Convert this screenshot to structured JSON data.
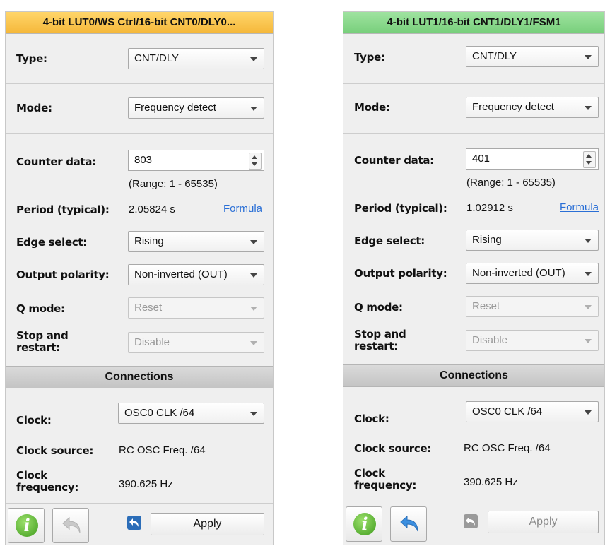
{
  "panels": [
    {
      "title": "4-bit LUT0/WS Ctrl/16-bit CNT0/DLY0...",
      "title_color": "#f5b83a",
      "type": {
        "label": "Type:",
        "value": "CNT/DLY"
      },
      "mode": {
        "label": "Mode:",
        "value": "Frequency detect"
      },
      "counter": {
        "label": "Counter data:",
        "value": "803",
        "range": "(Range:  1 - 65535)"
      },
      "period": {
        "label": "Period (typical):",
        "value": "2.05824 s",
        "formula": "Formula"
      },
      "edge": {
        "label": "Edge select:",
        "value": "Rising"
      },
      "polarity": {
        "label": "Output polarity:",
        "value": "Non-inverted (OUT)"
      },
      "qmode": {
        "label": "Q mode:",
        "value": "Reset"
      },
      "stop": {
        "label": "Stop and restart:",
        "value": "Disable"
      },
      "connections": "Connections",
      "clock": {
        "label": "Clock:",
        "value": "OSC0 CLK /64"
      },
      "clock_source": {
        "label": "Clock source:",
        "value": "RC OSC Freq. /64"
      },
      "clock_freq": {
        "label": "Clock frequency:",
        "value": "390.625 Hz"
      },
      "apply": "Apply",
      "undo_enabled": false,
      "apply_enabled": true
    },
    {
      "title": "4-bit LUT1/16-bit CNT1/DLY1/FSM1",
      "title_color": "#78cf7b",
      "type": {
        "label": "Type:",
        "value": "CNT/DLY"
      },
      "mode": {
        "label": "Mode:",
        "value": "Frequency detect"
      },
      "counter": {
        "label": "Counter data:",
        "value": "401",
        "range": "(Range:  1 - 65535)"
      },
      "period": {
        "label": "Period (typical):",
        "value": "1.02912 s",
        "formula": "Formula"
      },
      "edge": {
        "label": "Edge select:",
        "value": "Rising"
      },
      "polarity": {
        "label": "Output polarity:",
        "value": "Non-inverted (OUT)"
      },
      "qmode": {
        "label": "Q mode:",
        "value": "Reset"
      },
      "stop": {
        "label": "Stop and restart:",
        "value": "Disable"
      },
      "connections": "Connections",
      "clock": {
        "label": "Clock:",
        "value": "OSC0 CLK /64"
      },
      "clock_source": {
        "label": "Clock source:",
        "value": "RC OSC Freq. /64"
      },
      "clock_freq": {
        "label": "Clock frequency:",
        "value": "390.625 Hz"
      },
      "apply": "Apply",
      "undo_enabled": true,
      "apply_enabled": false
    }
  ],
  "icons": {
    "info": "info-icon",
    "undo": "undo-icon"
  }
}
